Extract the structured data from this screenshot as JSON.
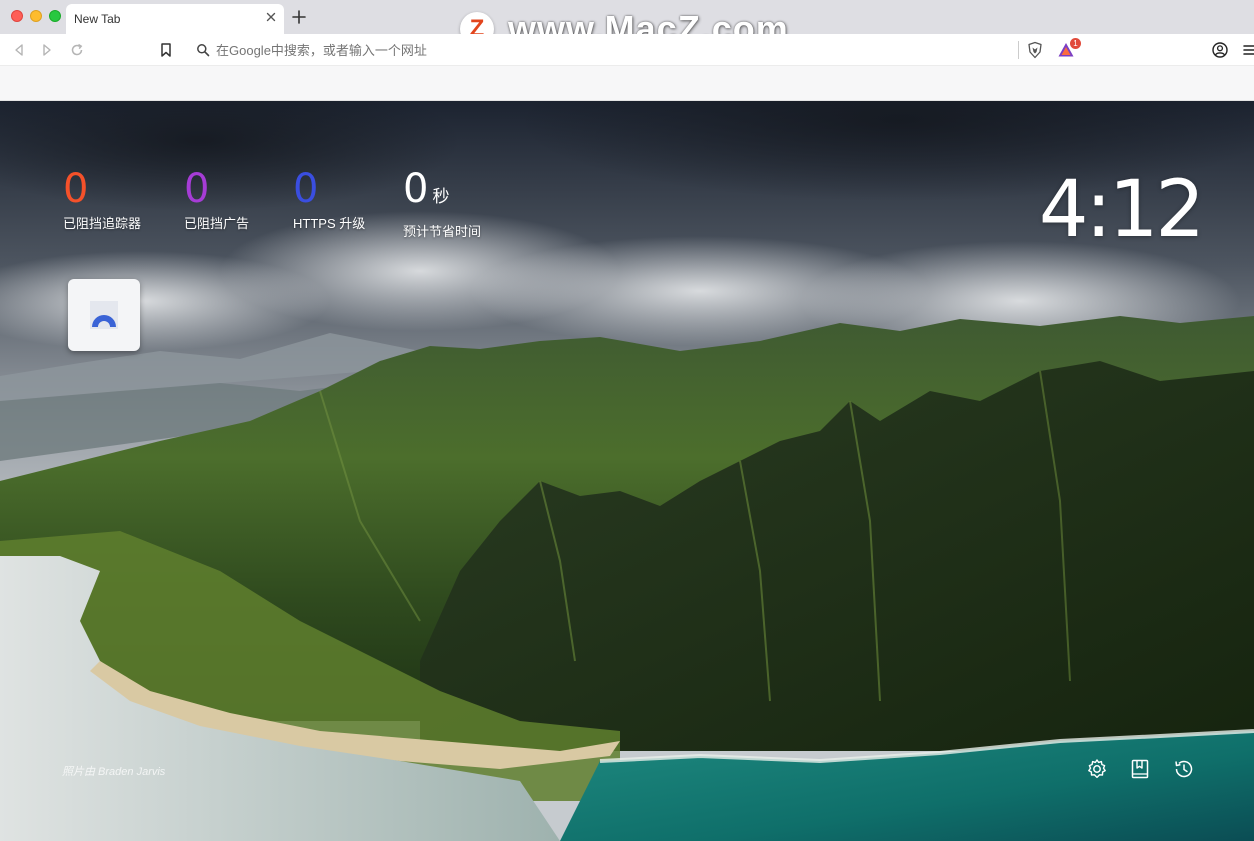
{
  "window": {
    "tab_title": "New Tab"
  },
  "watermark": {
    "logo_letter": "Z",
    "text": "www.MacZ.com"
  },
  "toolbar": {
    "search_placeholder": "在Google中搜索，或者输入一个网址",
    "rewards_badge": "1"
  },
  "stats": [
    {
      "value": "0",
      "unit": "",
      "label": "已阻挡追踪器",
      "color": "#f5512a"
    },
    {
      "value": "0",
      "unit": "",
      "label": "已阻挡广告",
      "color": "#a63cd6"
    },
    {
      "value": "0",
      "unit": "",
      "label": "HTTPS 升级",
      "color": "#3a4ee0"
    },
    {
      "value": "0",
      "unit": "秒",
      "label": "预计节省时间",
      "color": "#ffffff"
    }
  ],
  "clock": "4:12",
  "photo_credit": "照片由 Braden Jarvis",
  "icons": [
    "back-icon",
    "forward-icon",
    "reload-icon",
    "bookmark-icon",
    "search-icon",
    "brave-shield-icon",
    "brave-rewards-icon",
    "profile-icon",
    "menu-icon",
    "settings-icon",
    "bookmarks-icon",
    "history-icon"
  ]
}
